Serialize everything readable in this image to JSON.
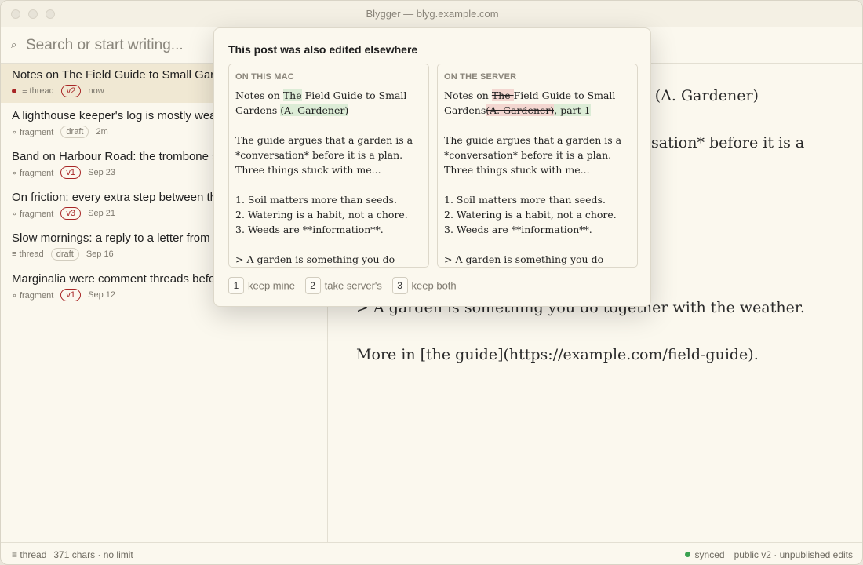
{
  "window": {
    "title": "Blygger — blyg.example.com"
  },
  "search": {
    "placeholder": "Search or start writing..."
  },
  "sidebar": {
    "posts": [
      {
        "title": "Notes on The Field Guide to Small Gardens (A. Gardener)",
        "kind": "≡ thread",
        "version": "v2",
        "time": "now",
        "unsaved": true,
        "active": true
      },
      {
        "title": "A lighthouse keeper's log is mostly weather",
        "kind": "∘ fragment",
        "status": "draft",
        "time": "2m"
      },
      {
        "title": "Band on Harbour Road: the trombone section",
        "kind": "∘ fragment",
        "version": "v1",
        "time": "Sep 23"
      },
      {
        "title": "On friction: every extra step between thought and post",
        "kind": "∘ fragment",
        "version": "v3",
        "time": "Sep 21"
      },
      {
        "title": "Slow mornings: a reply to a letter from a friend",
        "kind": "≡ thread",
        "status": "draft",
        "time": "Sep 16"
      },
      {
        "title": "Marginalia were comment threads before comment threads",
        "kind": "∘ fragment",
        "version": "v1",
        "time": "Sep 12"
      }
    ]
  },
  "editor": {
    "line1_tail": "s (A. Gardener)",
    "line2_tail": "sation* before it is a",
    "line3": "> A garden is something you do together with the weather.",
    "line4": "More in [the guide](https://example.com/field-guide)."
  },
  "conflict": {
    "title": "This post was also edited elsewhere",
    "mine_label": "ON THIS MAC",
    "server_label": "ON THE SERVER",
    "mine": {
      "l1a": "Notes on ",
      "l1b": "The",
      "l1c": " Field Guide to Small",
      "l2a": "Gardens ",
      "l2b": "(A. Gardener)",
      "p1": "The guide argues that a garden is a",
      "p2": "*conversation* before it is a plan.",
      "p3": "Three things stuck with me...",
      "li1": "1. Soil matters more than seeds.",
      "li2": "2. Watering is a habit, not a chore.",
      "li3": "3. Weeds are **information**.",
      "q": "> A garden is something you do"
    },
    "server": {
      "l1a": "Notes on ",
      "l1b": "The ",
      "l1c": "Field Guide to Small",
      "l2a": "Gardens",
      "l2b": "(A. Gardener)",
      "l2c": ", part 1",
      "p1": "The guide argues that a garden is a",
      "p2": "*conversation* before it is a plan.",
      "p3": "Three things stuck with me...",
      "li1": "1. Soil matters more than seeds.",
      "li2": "2. Watering is a habit, not a chore.",
      "li3": "3. Weeds are **information**.",
      "q": "> A garden is something you do"
    },
    "choices": [
      {
        "key": "1",
        "label": "keep mine"
      },
      {
        "key": "2",
        "label": "take server's"
      },
      {
        "key": "3",
        "label": "keep both"
      }
    ]
  },
  "status": {
    "kind": "≡ thread",
    "count": "371 chars · no limit",
    "sync": "synced",
    "visibility": "public v2 · unpublished edits"
  },
  "colors": {
    "accent_red": "#a82626",
    "sync_green": "#3aa150",
    "diff_add": "#dcecd6",
    "diff_del": "#f3d6d0"
  }
}
